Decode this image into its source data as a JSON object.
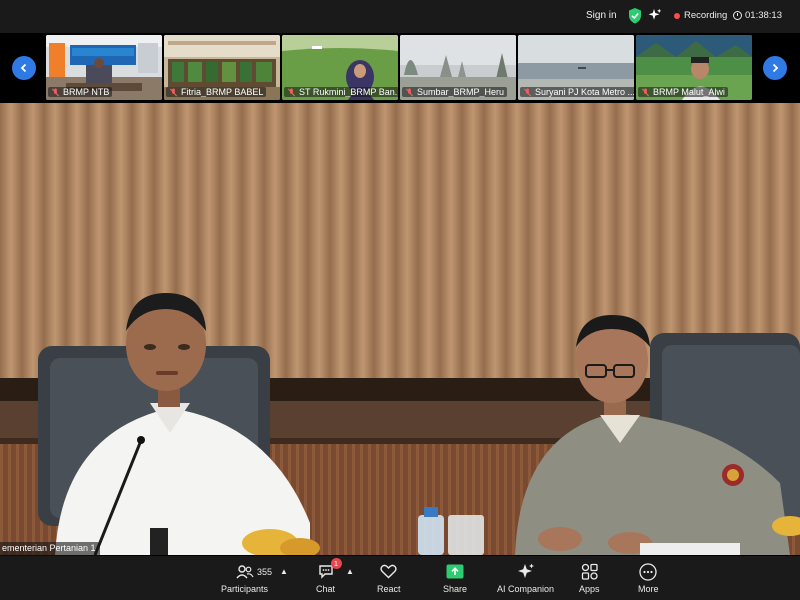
{
  "topbar": {
    "sign_in": "Sign in",
    "recording_label": "Recording",
    "timer": "01:38:13",
    "recording_color": "#ff4b4b",
    "shield_color": "#2ecc71"
  },
  "gallery": {
    "participants": [
      {
        "name": "BRMP NTB"
      },
      {
        "name": "Fitria_BRMP BABEL"
      },
      {
        "name": "ST Rukmini_BRMP Ban..."
      },
      {
        "name": "Sumbar_BRMP_Heru"
      },
      {
        "name": "Suryani PJ Kota Metro ..."
      },
      {
        "name": "BRMP Malut_Alwi"
      }
    ],
    "tile_texts": {
      "ntb_banner": ""
    }
  },
  "main_video": {
    "speaker_label": "ementerian Pertanian 1"
  },
  "toolbar": {
    "participants_label": "Participants",
    "participants_count": "355",
    "chat_label": "Chat",
    "chat_badge": "1",
    "react_label": "React",
    "share_label": "Share",
    "ai_label": "AI Companion",
    "apps_label": "Apps",
    "more_label": "More",
    "accent_color": "#2ecc71"
  }
}
